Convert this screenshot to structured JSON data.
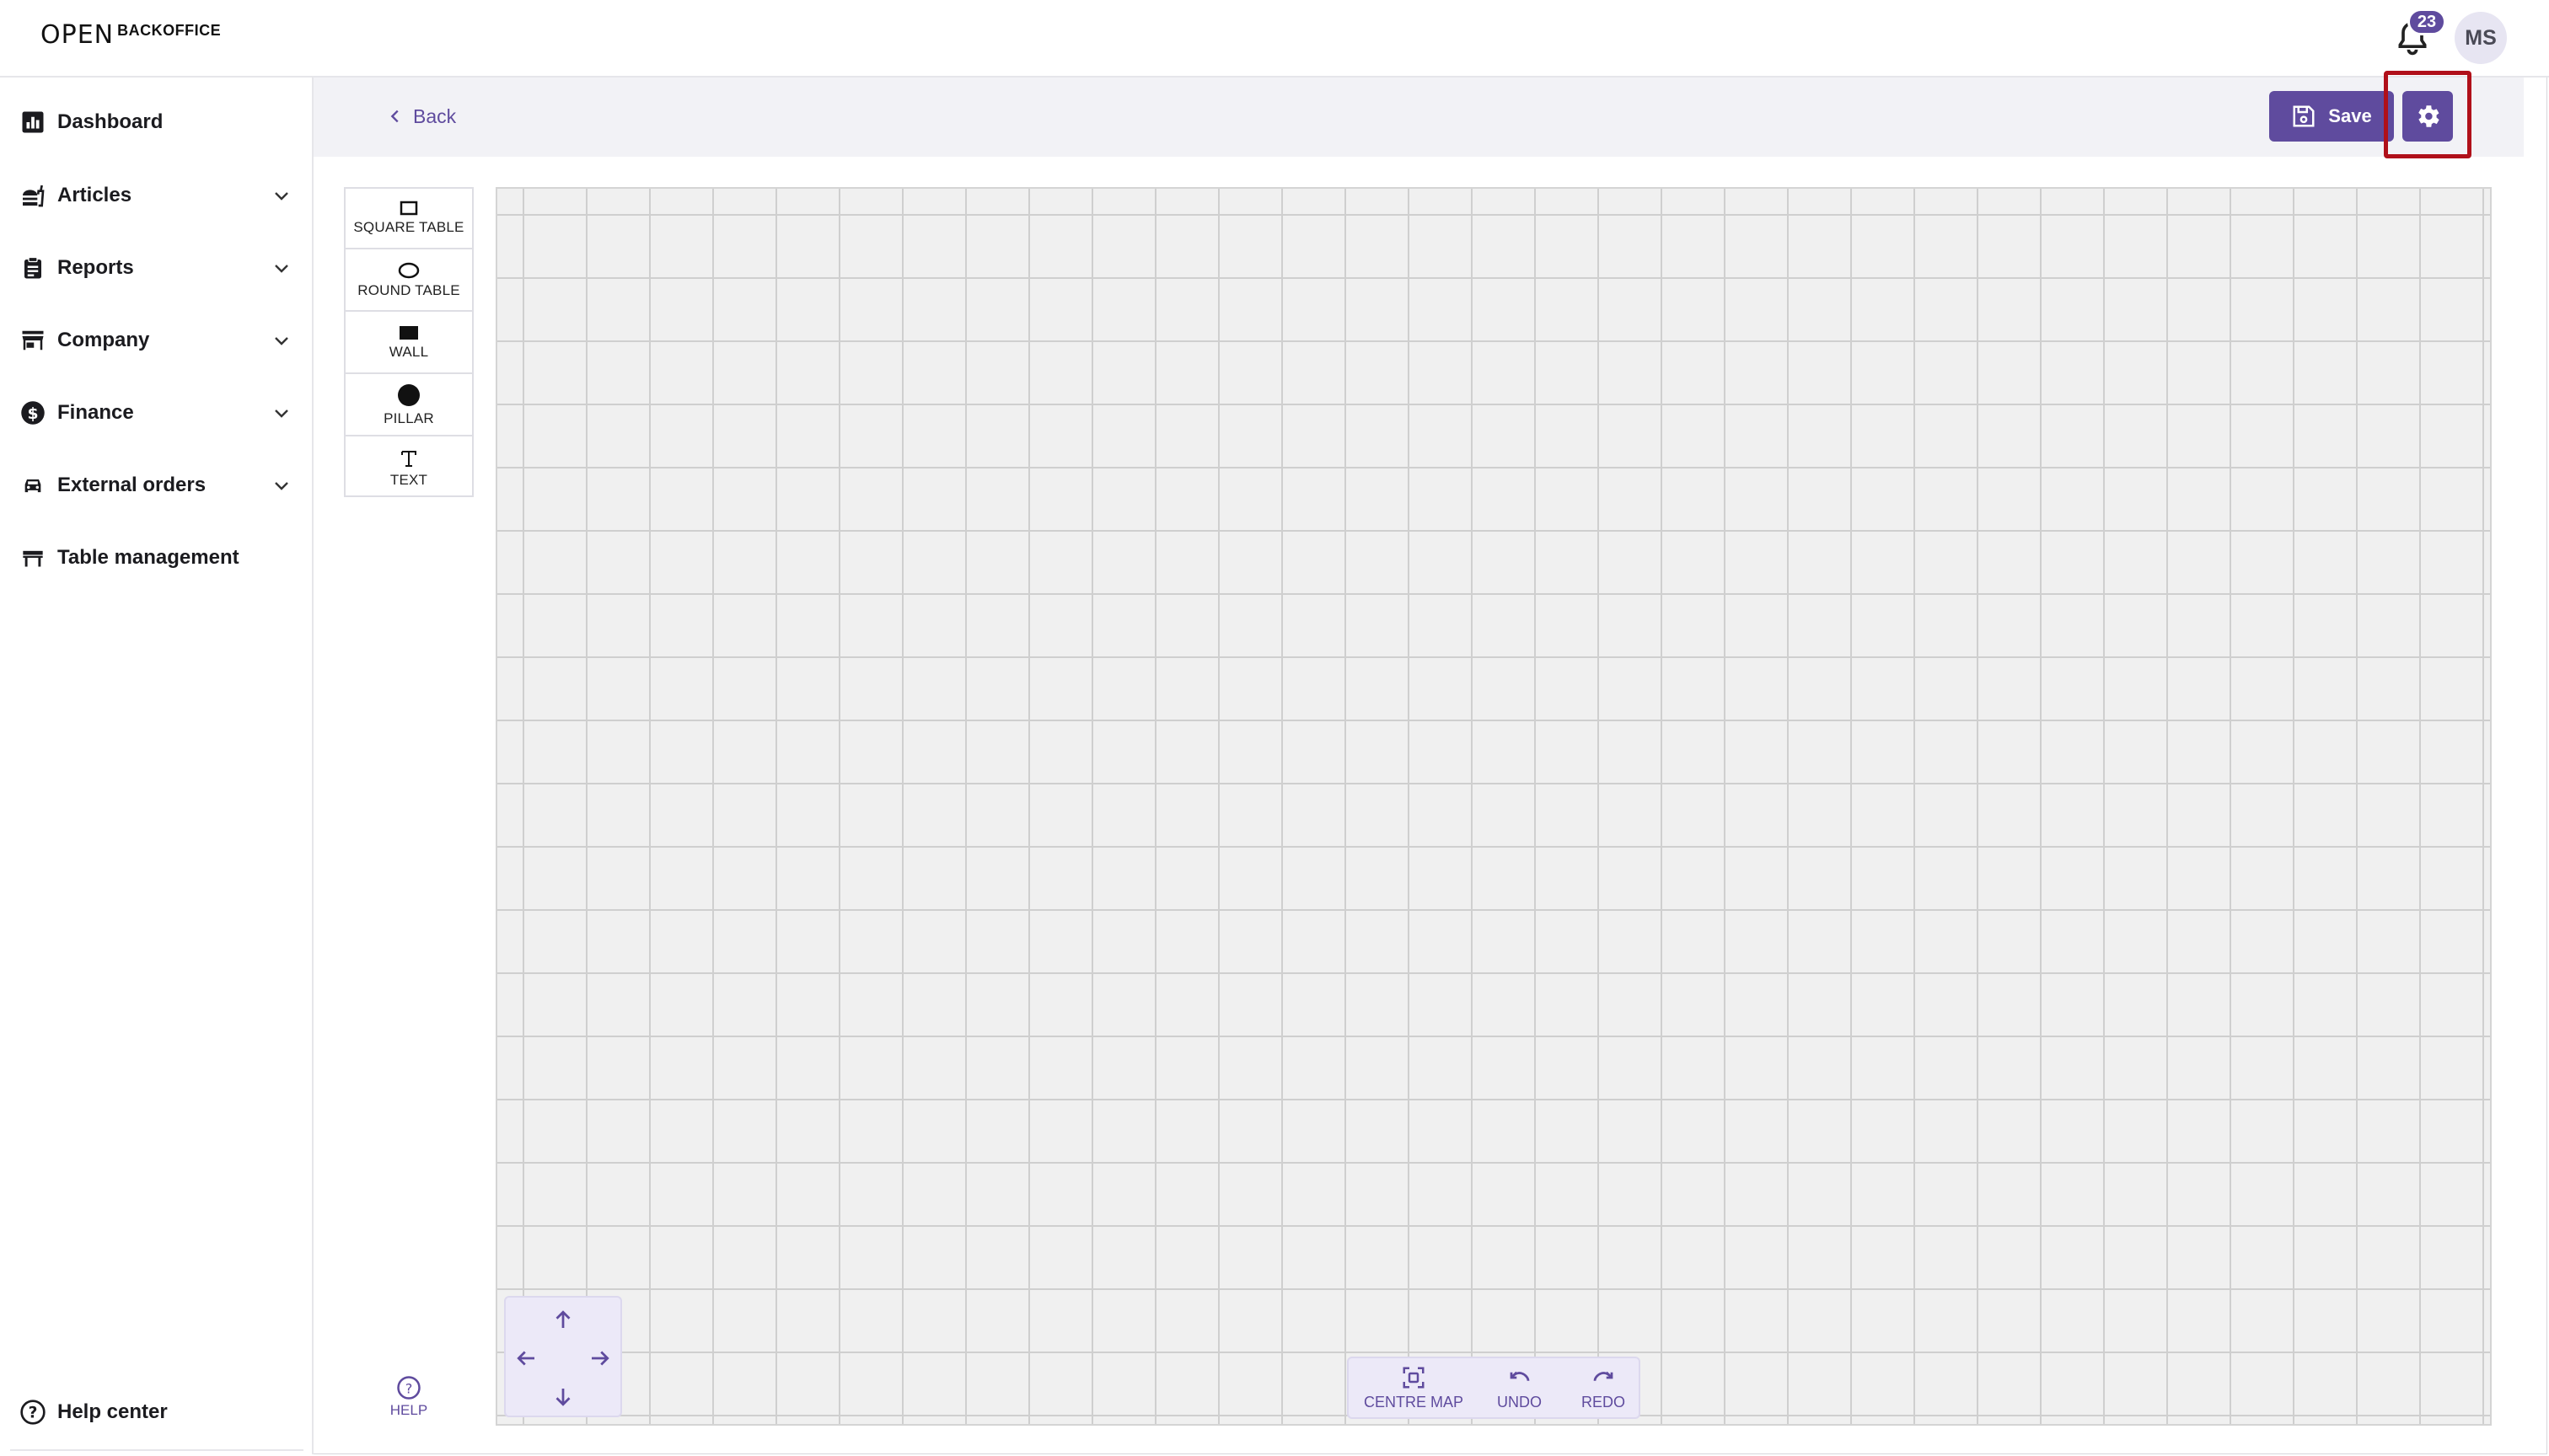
{
  "brand": {
    "logo_mark": "OPEN",
    "product": "BACKOFFICE"
  },
  "header": {
    "notification_count": "23",
    "user_initials": "MS"
  },
  "sidebar": {
    "items": [
      {
        "label": "Dashboard",
        "icon": "bar-chart-icon",
        "expandable": false
      },
      {
        "label": "Articles",
        "icon": "food-icon",
        "expandable": true
      },
      {
        "label": "Reports",
        "icon": "clipboard-icon",
        "expandable": true
      },
      {
        "label": "Company",
        "icon": "store-icon",
        "expandable": true
      },
      {
        "label": "Finance",
        "icon": "dollar-circle-icon",
        "expandable": true
      },
      {
        "label": "External orders",
        "icon": "car-icon",
        "expandable": true
      },
      {
        "label": "Table management",
        "icon": "table-icon",
        "expandable": false
      }
    ],
    "help_center": "Help center"
  },
  "subheader": {
    "back_label": "Back",
    "save_label": "Save",
    "settings_icon": "gear-icon"
  },
  "palette": {
    "tools": [
      {
        "label": "SQUARE TABLE",
        "icon": "square-outline-icon"
      },
      {
        "label": "ROUND TABLE",
        "icon": "ellipse-outline-icon"
      },
      {
        "label": "WALL",
        "icon": "filled-rectangle-icon"
      },
      {
        "label": "PILLAR",
        "icon": "filled-circle-icon"
      },
      {
        "label": "TEXT",
        "icon": "text-t-icon"
      }
    ],
    "help_label": "HELP"
  },
  "map_controls": {
    "centre_label": "CENTRE MAP",
    "undo_label": "UNDO",
    "redo_label": "REDO"
  },
  "colors": {
    "accent": "#5f4b9e",
    "highlight": "#b0101a",
    "grid_bg": "#f0f0f0",
    "grid_line": "#cfcfcf",
    "panel_bg": "#ece9f8"
  }
}
